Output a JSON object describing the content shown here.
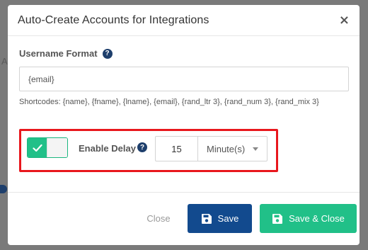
{
  "backdrop": {
    "fragment_text": "Ac"
  },
  "modal": {
    "title": "Auto-Create Accounts for Integrations",
    "close_glyph": "×"
  },
  "username_format": {
    "label": "Username Format",
    "help_glyph": "?",
    "value": "{email}",
    "shortcodes_text": "Shortcodes: {name}, {fname}, {lname}, {email}, {rand_ltr 3}, {rand_num 3}, {rand_mix 3}"
  },
  "delay": {
    "toggle_state": "on",
    "label": "Enable Delay",
    "help_glyph": "?",
    "amount": "15",
    "unit": "Minute(s)",
    "highlighted": true
  },
  "footer": {
    "close_label": "Close",
    "save_label": "Save",
    "save_close_label": "Save & Close"
  },
  "icons": {
    "toggle_check": "check-icon",
    "save": "floppy-disk-icon",
    "save_close": "floppy-disk-icon",
    "help": "question-circle-icon",
    "dropdown": "caret-down-icon"
  },
  "colors": {
    "primary": "#124a8e",
    "success": "#21c088",
    "highlight": "#e8171d",
    "help_icon": "#1e3f6c"
  }
}
